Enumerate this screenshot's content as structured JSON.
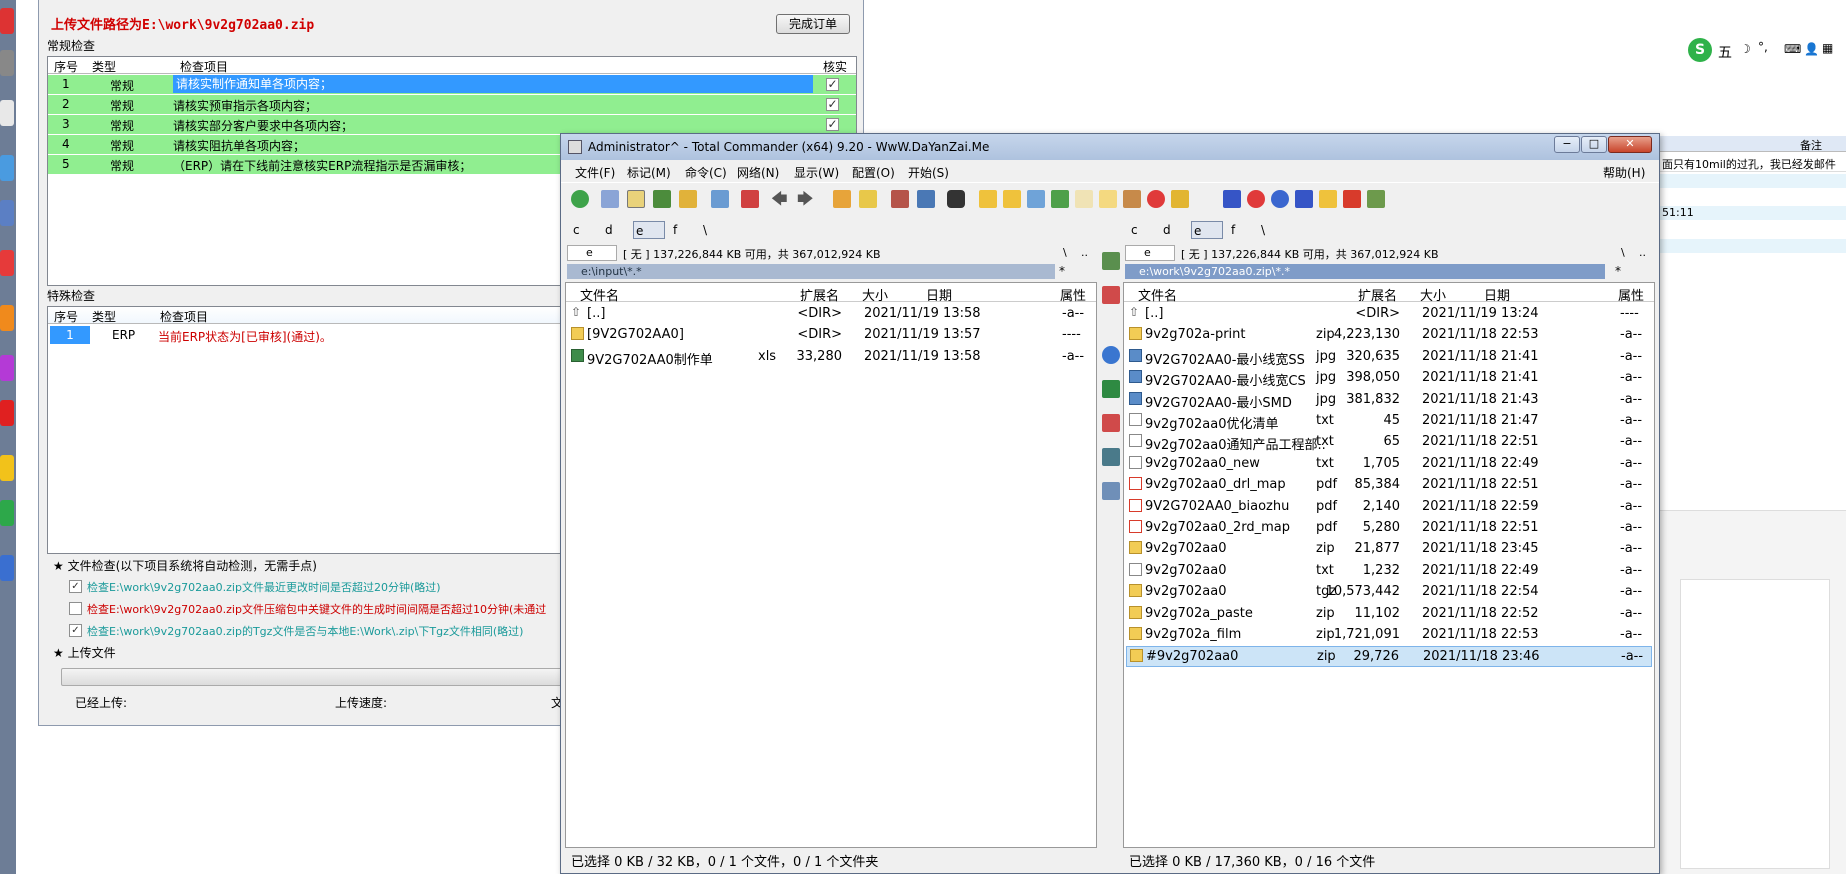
{
  "upload_window": {
    "title": "上传文件路径为E:\\work\\9v2g702aa0.zip",
    "finish_button": "完成订单",
    "normal_check": {
      "group_label": "常规检查",
      "headers": [
        "序号",
        "类型",
        "检查项目",
        "核实"
      ],
      "rows": [
        {
          "no": "1",
          "type": "常规",
          "item": "请核实制作通知单各项内容；",
          "checked": "✓"
        },
        {
          "no": "2",
          "type": "常规",
          "item": "请核实预审指示各项内容；",
          "checked": "✓"
        },
        {
          "no": "3",
          "type": "常规",
          "item": "请核实部分客户要求中各项内容；",
          "checked": "✓"
        },
        {
          "no": "4",
          "type": "常规",
          "item": "请核实阻抗单各项内容；",
          "checked": "✓"
        },
        {
          "no": "5",
          "type": "常规",
          "item": "（ERP）请在下线前注意核实ERP流程指示是否漏审核；",
          "checked": "✓"
        }
      ]
    },
    "special_check": {
      "group_label": "特殊检查",
      "headers": [
        "序号",
        "类型",
        "检查项目"
      ],
      "rows": [
        {
          "no": "1",
          "type": "ERP",
          "item": "当前ERP状态为[已审核](通过)。"
        }
      ]
    },
    "file_check": {
      "header": "★ 文件检查(以下项目系统将自动检测，无需手点)",
      "items": [
        {
          "checked": "✓",
          "text": "检查E:\\work\\9v2g702aa0.zip文件最近更改时间是否超过20分钟(略过)"
        },
        {
          "checked": "",
          "text": "检查E:\\work\\9v2g702aa0.zip文件压缩包中关键文件的生成时间间隔是否超过10分钟(未通过"
        },
        {
          "checked": "✓",
          "text": "检查E:\\work\\9v2g702aa0.zip的Tgz文件是否与本地E:\\Work\\.zip\\下Tgz文件相同(略过)"
        }
      ]
    },
    "upload": {
      "header": "★ 上传文件",
      "uploaded_label": "已经上传:",
      "speed_label": "上传速度:",
      "extra_label": "文"
    }
  },
  "right_side": {
    "ime_text": "五",
    "note_header": "备注",
    "note_text": "面只有10mil的过孔，我已经发邮件",
    "time_fragment": "51:11"
  },
  "tc": {
    "title": "Administrator^ - Total Commander (x64) 9.20 - WwW.DaYanZai.Me",
    "window_buttons": [
      "−",
      "□",
      "✕"
    ],
    "menu": [
      "文件(F)",
      "标记(M)",
      "命令(C)",
      "网络(N)",
      "显示(W)",
      "配置(O)",
      "开始(S)"
    ],
    "help": "帮助(H)",
    "drives": [
      "c",
      "d",
      "e",
      "f",
      "\\"
    ],
    "left": {
      "drive_sel": "e",
      "free": "[ 无 ]  137,226,844 KB 可用，共 367,012,924 KB",
      "root": "\\",
      "up": "..",
      "path": "e:\\input\\*.*",
      "star": "*",
      "headers": [
        "文件名",
        "扩展名",
        "大小",
        "日期",
        "属性"
      ],
      "files": [
        {
          "icon": "up",
          "name": "[..]",
          "ext": "",
          "size": "<DIR>",
          "date": "2021/11/19 13:58",
          "attr": "-a--"
        },
        {
          "icon": "folder",
          "name": "[9V2G702AA0]",
          "ext": "",
          "size": "<DIR>",
          "date": "2021/11/19 13:57",
          "attr": "----"
        },
        {
          "icon": "xls",
          "name": "9V2G702AA0制作单",
          "ext": "xls",
          "size": "33,280",
          "date": "2021/11/19 13:58",
          "attr": "-a--"
        }
      ],
      "status": "已选择 0 KB / 32 KB，0 / 1 个文件，0 / 1 个文件夹"
    },
    "right": {
      "drive_sel": "e",
      "free": "[ 无 ]  137,226,844 KB 可用，共 367,012,924 KB",
      "root": "\\",
      "up": "..",
      "path": "e:\\work\\9v2g702aa0.zip\\*.*",
      "star": "*",
      "headers": [
        "文件名",
        "扩展名",
        "大小",
        "日期",
        "属性"
      ],
      "files": [
        {
          "icon": "up",
          "name": "[..]",
          "ext": "",
          "size": "<DIR>",
          "date": "2021/11/19 13:24",
          "attr": "----"
        },
        {
          "icon": "zip",
          "name": "9v2g702a-print",
          "ext": "zip",
          "size": "4,223,130",
          "date": "2021/11/18 22:53",
          "attr": "-a--"
        },
        {
          "icon": "jpg",
          "name": "9V2G702AA0-最小线宽SS",
          "ext": "jpg",
          "size": "320,635",
          "date": "2021/11/18 21:41",
          "attr": "-a--"
        },
        {
          "icon": "jpg",
          "name": "9V2G702AA0-最小线宽CS",
          "ext": "jpg",
          "size": "398,050",
          "date": "2021/11/18 21:41",
          "attr": "-a--"
        },
        {
          "icon": "jpg",
          "name": "9V2G702AA0-最小SMD",
          "ext": "jpg",
          "size": "381,832",
          "date": "2021/11/18 21:43",
          "attr": "-a--"
        },
        {
          "icon": "txt",
          "name": "9v2g702aa0优化清单",
          "ext": "txt",
          "size": "45",
          "date": "2021/11/18 21:47",
          "attr": "-a--"
        },
        {
          "icon": "txt",
          "name": "9v2g702aa0通知产品工程部..",
          "ext": "txt",
          "size": "65",
          "date": "2021/11/18 22:51",
          "attr": "-a--"
        },
        {
          "icon": "txt",
          "name": "9v2g702aa0_new",
          "ext": "txt",
          "size": "1,705",
          "date": "2021/11/18 22:49",
          "attr": "-a--"
        },
        {
          "icon": "pdf",
          "name": "9v2g702aa0_drl_map",
          "ext": "pdf",
          "size": "85,384",
          "date": "2021/11/18 22:51",
          "attr": "-a--"
        },
        {
          "icon": "pdf",
          "name": "9V2G702AA0_biaozhu",
          "ext": "pdf",
          "size": "2,140",
          "date": "2021/11/18 22:59",
          "attr": "-a--"
        },
        {
          "icon": "pdf",
          "name": "9v2g702aa0_2rd_map",
          "ext": "pdf",
          "size": "5,280",
          "date": "2021/11/18 22:51",
          "attr": "-a--"
        },
        {
          "icon": "zip",
          "name": "9v2g702aa0",
          "ext": "zip",
          "size": "21,877",
          "date": "2021/11/18 23:45",
          "attr": "-a--"
        },
        {
          "icon": "txt",
          "name": "9v2g702aa0",
          "ext": "txt",
          "size": "1,232",
          "date": "2021/11/18 22:49",
          "attr": "-a--"
        },
        {
          "icon": "zip",
          "name": "9v2g702aa0",
          "ext": "tgz",
          "size": "10,573,442",
          "date": "2021/11/18 22:54",
          "attr": "-a--"
        },
        {
          "icon": "zip",
          "name": "9v2g702a_paste",
          "ext": "zip",
          "size": "11,102",
          "date": "2021/11/18 22:52",
          "attr": "-a--"
        },
        {
          "icon": "zip",
          "name": "9v2g702a_film",
          "ext": "zip",
          "size": "1,721,091",
          "date": "2021/11/18 22:53",
          "attr": "-a--"
        },
        {
          "icon": "zip",
          "name": "#9v2g702aa0",
          "ext": "zip",
          "size": "29,726",
          "date": "2021/11/18 23:46",
          "attr": "-a--"
        }
      ],
      "status": "已选择 0 KB / 17,360 KB，0 / 16 个文件"
    }
  },
  "colors": {
    "check_green": "#90ee90",
    "selected_blue": "#3399ff",
    "error_red": "#cc0000",
    "pass_teal": "#1a9a9a",
    "title_red": "#d00000"
  }
}
